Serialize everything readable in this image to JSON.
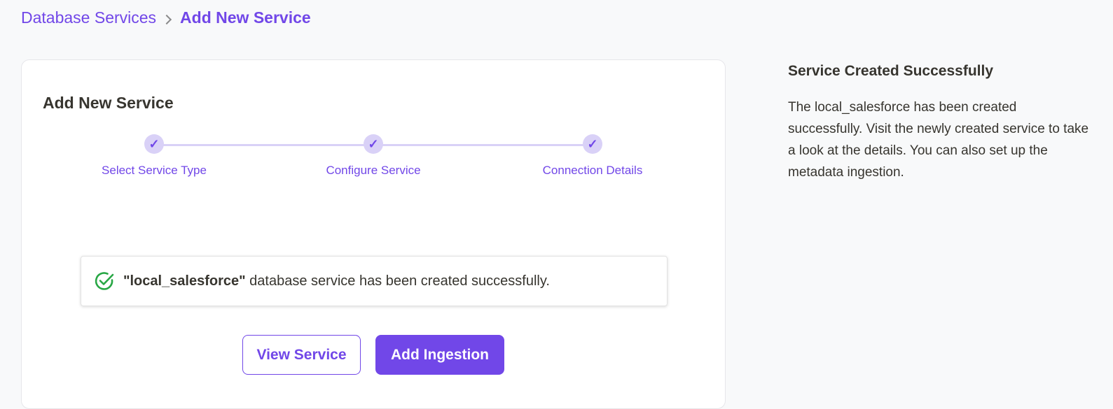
{
  "breadcrumb": {
    "parent": "Database Services",
    "current": "Add New Service"
  },
  "card": {
    "title": "Add New Service",
    "steps": [
      {
        "label": "Select Service Type",
        "status": "completed"
      },
      {
        "label": "Configure Service",
        "status": "completed"
      },
      {
        "label": "Connection Details",
        "status": "completed"
      }
    ],
    "success": {
      "service_name": "\"local_salesforce\"",
      "message": " database service has been created successfully."
    },
    "buttons": {
      "view_service": "View Service",
      "add_ingestion": "Add Ingestion"
    }
  },
  "side_panel": {
    "title": "Service Created Successfully",
    "text": "The local_salesforce has been created successfully. Visit the newly created service to take a look at the details. You can also set up the metadata ingestion."
  },
  "colors": {
    "accent": "#7147e8",
    "step_dot": "#d9d1f7",
    "success": "#28a745"
  },
  "icons": {
    "step_done": "✓",
    "breadcrumb_separator": "chevron-right-icon",
    "success": "check-circle-icon"
  }
}
